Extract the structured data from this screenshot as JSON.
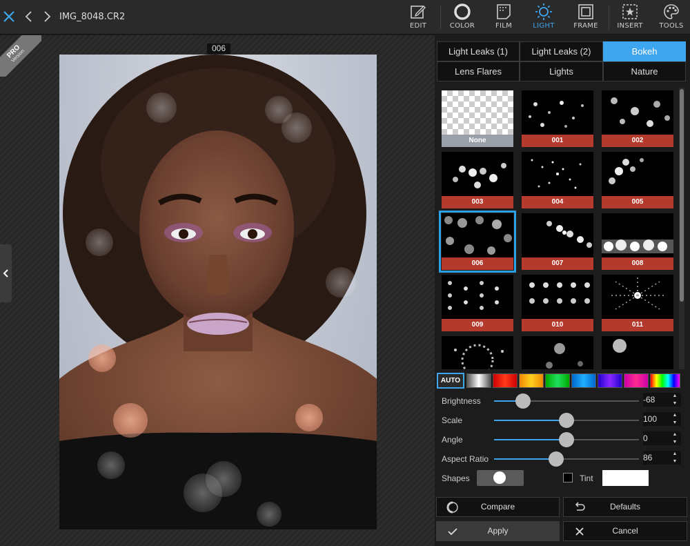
{
  "header": {
    "filename": "IMG_8048.CR2",
    "tools": [
      {
        "label": "EDIT",
        "icon": "edit-icon"
      },
      {
        "label": "COLOR",
        "icon": "color-icon"
      },
      {
        "label": "FILM",
        "icon": "film-icon"
      },
      {
        "label": "LIGHT",
        "icon": "light-icon",
        "active": true
      },
      {
        "label": "FRAME",
        "icon": "frame-icon"
      },
      {
        "label": "INSERT",
        "icon": "insert-icon"
      },
      {
        "label": "TOOLS",
        "icon": "tools-icon"
      }
    ]
  },
  "canvas": {
    "pro_badge": {
      "title": "PRO",
      "subtitle": "Version"
    },
    "photo_label": "006"
  },
  "panel": {
    "tabs": [
      {
        "label": "Light Leaks (1)"
      },
      {
        "label": "Light Leaks (2)"
      },
      {
        "label": "Bokeh",
        "active": true
      },
      {
        "label": "Lens Flares"
      },
      {
        "label": "Lights"
      },
      {
        "label": "Nature"
      }
    ],
    "thumbnails": [
      {
        "label": "None"
      },
      {
        "label": "001"
      },
      {
        "label": "002"
      },
      {
        "label": "003"
      },
      {
        "label": "004"
      },
      {
        "label": "005"
      },
      {
        "label": "006",
        "selected": true
      },
      {
        "label": "007"
      },
      {
        "label": "008"
      },
      {
        "label": "009"
      },
      {
        "label": "010"
      },
      {
        "label": "011"
      },
      {
        "label": ""
      },
      {
        "label": ""
      },
      {
        "label": ""
      }
    ],
    "auto_label": "AUTO",
    "swatches": [
      "#c8c8c8",
      "#ff3a1a",
      "#ffd020",
      "#20e060",
      "#2090ff",
      "#8a2aff",
      "#ff2a90",
      "#ff8a00"
    ],
    "sliders": [
      {
        "label": "Brightness",
        "value": "-68",
        "fraction": 0.2
      },
      {
        "label": "Scale",
        "value": "100",
        "fraction": 0.5
      },
      {
        "label": "Angle",
        "value": "0",
        "fraction": 0.5
      },
      {
        "label": "Aspect Ratio",
        "value": "86",
        "fraction": 0.43
      }
    ],
    "shapes_label": "Shapes",
    "tint_label": "Tint",
    "tint_color": "#ffffff",
    "buttons": {
      "compare": "Compare",
      "defaults": "Defaults",
      "apply": "Apply",
      "cancel": "Cancel"
    }
  },
  "colors": {
    "accent": "#3ea6ee",
    "thumb_label_bg": "#b53a2e"
  }
}
